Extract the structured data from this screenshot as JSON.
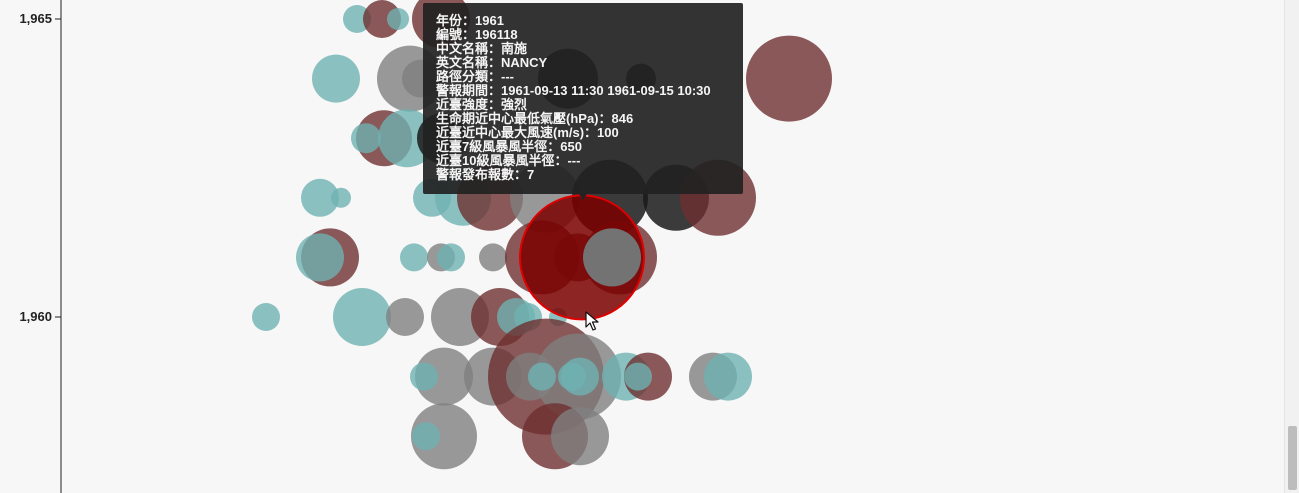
{
  "chart_data": {
    "type": "scatter",
    "title": "",
    "xlabel": "",
    "ylabel": "",
    "y_ticks": [
      {
        "value": 1965,
        "label": "1,965"
      },
      {
        "value": 1960,
        "label": "1,960"
      }
    ],
    "ylim": [
      1957,
      1965.3
    ],
    "xlim": [
      0,
      1220
    ],
    "colors": {
      "teal": "#6fb1b1",
      "gray": "#7f7f7f",
      "dark": "#1a1a1a",
      "maroon": "#6e2f2f",
      "highlight_fill": "#7a0000",
      "highlight_stroke": "#e00000"
    },
    "points": [
      {
        "x": 357,
        "y": 1965,
        "r": 14,
        "color": "teal"
      },
      {
        "x": 382,
        "y": 1965,
        "r": 19,
        "color": "maroon"
      },
      {
        "x": 398,
        "y": 1965,
        "r": 11,
        "color": "teal"
      },
      {
        "x": 441,
        "y": 1965,
        "r": 29,
        "color": "maroon"
      },
      {
        "x": 336,
        "y": 1964,
        "r": 24,
        "color": "teal"
      },
      {
        "x": 410,
        "y": 1964,
        "r": 33,
        "color": "gray"
      },
      {
        "x": 421,
        "y": 1964,
        "r": 19,
        "color": "gray"
      },
      {
        "x": 568,
        "y": 1964,
        "r": 30,
        "color": "dark"
      },
      {
        "x": 641,
        "y": 1964,
        "r": 15,
        "color": "dark"
      },
      {
        "x": 789,
        "y": 1964,
        "r": 43,
        "color": "maroon"
      },
      {
        "x": 384,
        "y": 1963,
        "r": 28,
        "color": "maroon"
      },
      {
        "x": 366,
        "y": 1963,
        "r": 15,
        "color": "teal"
      },
      {
        "x": 407,
        "y": 1963,
        "r": 29,
        "color": "teal"
      },
      {
        "x": 442,
        "y": 1963,
        "r": 25,
        "color": "dark"
      },
      {
        "x": 320,
        "y": 1962,
        "r": 19,
        "color": "teal"
      },
      {
        "x": 341,
        "y": 1962,
        "r": 10,
        "color": "teal"
      },
      {
        "x": 432,
        "y": 1962,
        "r": 19,
        "color": "teal"
      },
      {
        "x": 463,
        "y": 1962,
        "r": 28,
        "color": "teal"
      },
      {
        "x": 490,
        "y": 1962,
        "r": 33,
        "color": "maroon"
      },
      {
        "x": 545,
        "y": 1962,
        "r": 35,
        "color": "gray"
      },
      {
        "x": 610,
        "y": 1962,
        "r": 38,
        "color": "dark"
      },
      {
        "x": 676,
        "y": 1962,
        "r": 33,
        "color": "dark"
      },
      {
        "x": 718,
        "y": 1962,
        "r": 38,
        "color": "maroon"
      },
      {
        "x": 330,
        "y": 1961,
        "r": 29,
        "color": "maroon"
      },
      {
        "x": 320,
        "y": 1961,
        "r": 24,
        "color": "teal"
      },
      {
        "x": 414,
        "y": 1961,
        "r": 14,
        "color": "teal"
      },
      {
        "x": 441,
        "y": 1961,
        "r": 14,
        "color": "gray"
      },
      {
        "x": 451,
        "y": 1961,
        "r": 14,
        "color": "teal"
      },
      {
        "x": 493,
        "y": 1961,
        "r": 14,
        "color": "gray"
      },
      {
        "x": 542,
        "y": 1961,
        "r": 37,
        "color": "maroon"
      },
      {
        "x": 620,
        "y": 1961,
        "r": 37,
        "color": "maroon"
      },
      {
        "x": 578,
        "y": 1961,
        "r": 24,
        "color": "maroon"
      },
      {
        "x": 612,
        "y": 1961,
        "r": 29,
        "color": "teal"
      },
      {
        "x": 266,
        "y": 1960,
        "r": 14,
        "color": "teal"
      },
      {
        "x": 362,
        "y": 1960,
        "r": 29,
        "color": "teal"
      },
      {
        "x": 405,
        "y": 1960,
        "r": 19,
        "color": "gray"
      },
      {
        "x": 460,
        "y": 1960,
        "r": 29,
        "color": "gray"
      },
      {
        "x": 500,
        "y": 1960,
        "r": 29,
        "color": "maroon"
      },
      {
        "x": 516,
        "y": 1960,
        "r": 19,
        "color": "teal"
      },
      {
        "x": 528,
        "y": 1960,
        "r": 14,
        "color": "teal"
      },
      {
        "x": 558,
        "y": 1960,
        "r": 9,
        "color": "teal"
      },
      {
        "x": 444,
        "y": 1959,
        "r": 29,
        "color": "gray"
      },
      {
        "x": 424,
        "y": 1959,
        "r": 14,
        "color": "teal"
      },
      {
        "x": 493,
        "y": 1959,
        "r": 29,
        "color": "gray"
      },
      {
        "x": 546,
        "y": 1959,
        "r": 58,
        "color": "maroon"
      },
      {
        "x": 578,
        "y": 1959,
        "r": 43,
        "color": "gray"
      },
      {
        "x": 530,
        "y": 1959,
        "r": 24,
        "color": "gray"
      },
      {
        "x": 542,
        "y": 1959,
        "r": 14,
        "color": "teal"
      },
      {
        "x": 572,
        "y": 1959,
        "r": 14,
        "color": "teal"
      },
      {
        "x": 580,
        "y": 1959,
        "r": 19,
        "color": "teal"
      },
      {
        "x": 626,
        "y": 1959,
        "r": 24,
        "color": "teal"
      },
      {
        "x": 648,
        "y": 1959,
        "r": 24,
        "color": "maroon"
      },
      {
        "x": 638,
        "y": 1959,
        "r": 14,
        "color": "teal"
      },
      {
        "x": 713,
        "y": 1959,
        "r": 24,
        "color": "gray"
      },
      {
        "x": 728,
        "y": 1959,
        "r": 24,
        "color": "teal"
      },
      {
        "x": 444,
        "y": 1958,
        "r": 33,
        "color": "gray"
      },
      {
        "x": 426,
        "y": 1958,
        "r": 14,
        "color": "teal"
      },
      {
        "x": 555,
        "y": 1958,
        "r": 33,
        "color": "maroon"
      },
      {
        "x": 580,
        "y": 1958,
        "r": 29,
        "color": "gray"
      }
    ],
    "highlight": {
      "x": 582,
      "y": 1961,
      "r": 62,
      "year": 1961,
      "id": "196118"
    }
  },
  "tooltip": {
    "rows": [
      "年份：1961",
      "編號：196118",
      "中文名稱：南施",
      "英文名稱：NANCY",
      "路徑分類：---",
      "警報期間：1961-09-13 11:30 1961-09-15 10:30",
      "近臺強度：強烈",
      "生命期近中心最低氣壓(hPa)：846",
      "近臺近中心最大風速(m/s)：100",
      "近臺7級風暴風半徑：650",
      "近臺10級風暴風半徑：---",
      "警報發布報數：7"
    ]
  }
}
